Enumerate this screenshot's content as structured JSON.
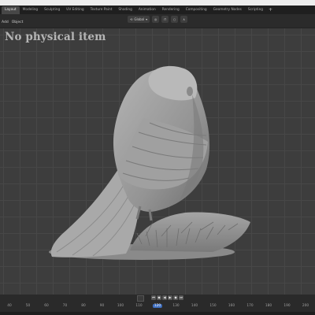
{
  "workspace_tabs": [
    "Layout",
    "Modeling",
    "Sculpting",
    "UV Editing",
    "Texture Paint",
    "Shading",
    "Animation",
    "Rendering",
    "Compositing",
    "Geometry Nodes",
    "Scripting"
  ],
  "tab_add": "+",
  "menu": {
    "add": "Add",
    "object": "Object"
  },
  "header_tools": {
    "orientation": "Global"
  },
  "watermark": "No physical item",
  "timeline": {
    "ticks": [
      "40",
      "50",
      "60",
      "70",
      "80",
      "90",
      "100",
      "110",
      "120",
      "130",
      "140",
      "150",
      "160",
      "170",
      "180",
      "190",
      "200"
    ],
    "current_frame": "120"
  },
  "colors": {
    "viewport_bg": "#3d3d3d",
    "grid": "#474747",
    "model": "#9a9a9a",
    "accent": "#3f6fbf"
  }
}
